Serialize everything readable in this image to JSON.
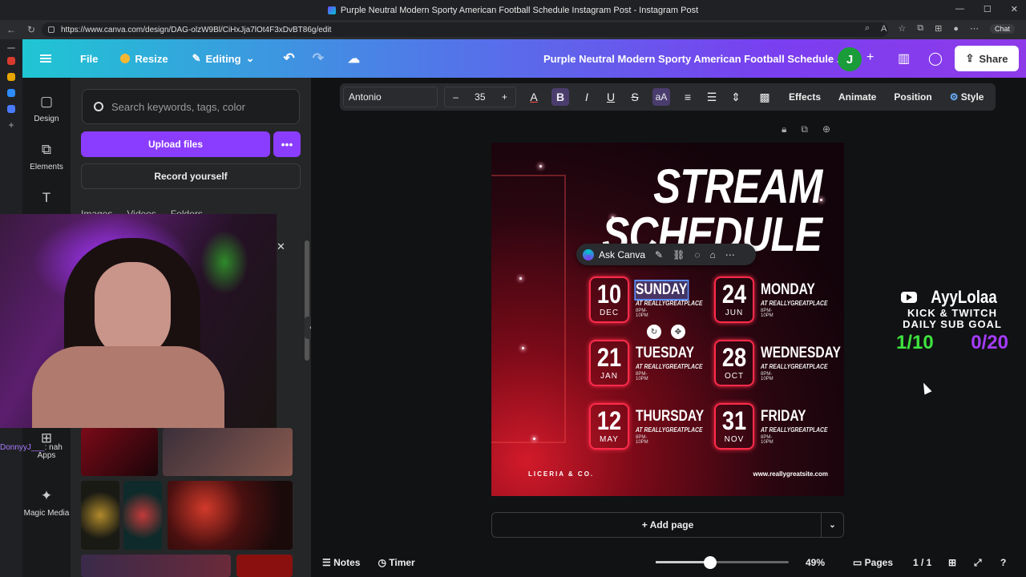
{
  "browser": {
    "tab_title": "Purple Neutral Modern Sporty American Football Schedule Instagram Post - Instagram Post",
    "url": "https://www.canva.com/design/DAG-olzW9Bl/CiHxJja7lOt4F3xDvBT86g/edit",
    "chat_label": "Chat"
  },
  "topbar": {
    "file": "File",
    "resize": "Resize",
    "editing": "Editing",
    "doc_title": "Purple Neutral Modern Sporty American Football Schedule ...",
    "avatar_initial": "J",
    "share": "Share"
  },
  "rail": {
    "design": "Design",
    "elements": "Elements",
    "apps": "Apps",
    "magic_media": "Magic Media"
  },
  "panel": {
    "search_placeholder": "Search keywords, tags, color",
    "upload": "Upload files",
    "record": "Record yourself",
    "tabs": [
      "Images",
      "Videos",
      "Folders"
    ]
  },
  "chat": {
    "user": "DonnyyJ___",
    "message": ": nah"
  },
  "toolbar": {
    "font": "Antonio",
    "size": "35",
    "effects": "Effects",
    "animate": "Animate",
    "position": "Position",
    "style": "Style"
  },
  "design": {
    "title_line1": "STREAM",
    "title_line2": "SCHEDULE",
    "days": [
      {
        "num": "10",
        "month": "DEC",
        "name": "SUNDAY",
        "place": "AT REALLYGREATPLACE",
        "time": "8PM-10PM"
      },
      {
        "num": "24",
        "month": "JUN",
        "name": "MONDAY",
        "place": "AT REALLYGREATPLACE",
        "time": "8PM-10PM"
      },
      {
        "num": "21",
        "month": "JAN",
        "name": "TUESDAY",
        "place": "AT REALLYGREATPLACE",
        "time": "8PM-10PM"
      },
      {
        "num": "28",
        "month": "OCT",
        "name": "WEDNESDAY",
        "place": "AT REALLYGREATPLACE",
        "time": "8PM-10PM"
      },
      {
        "num": "12",
        "month": "MAY",
        "name": "THURSDAY",
        "place": "AT REALLYGREATPLACE",
        "time": "8PM-10PM"
      },
      {
        "num": "31",
        "month": "NOV",
        "name": "FRIDAY",
        "place": "AT REALLYGREATPLACE",
        "time": "8PM-10PM"
      }
    ],
    "brand": "LICERIA & CO.",
    "site": "www.reallygreatsite.com"
  },
  "ask_canva": "Ask Canva",
  "overlay": {
    "name": "AyyLolaa",
    "line1": "KICK & TWITCH",
    "line2": "DAILY SUB GOAL",
    "count_green": "1/10",
    "count_purple": "0/20",
    "color_green": "#3ee23e",
    "color_purple": "#a53cff"
  },
  "add_page": "+ Add page",
  "bottom": {
    "notes": "Notes",
    "timer": "Timer",
    "zoom": "49%",
    "zoom_level": 0.41,
    "pages": "Pages",
    "page_count": "1 / 1"
  }
}
